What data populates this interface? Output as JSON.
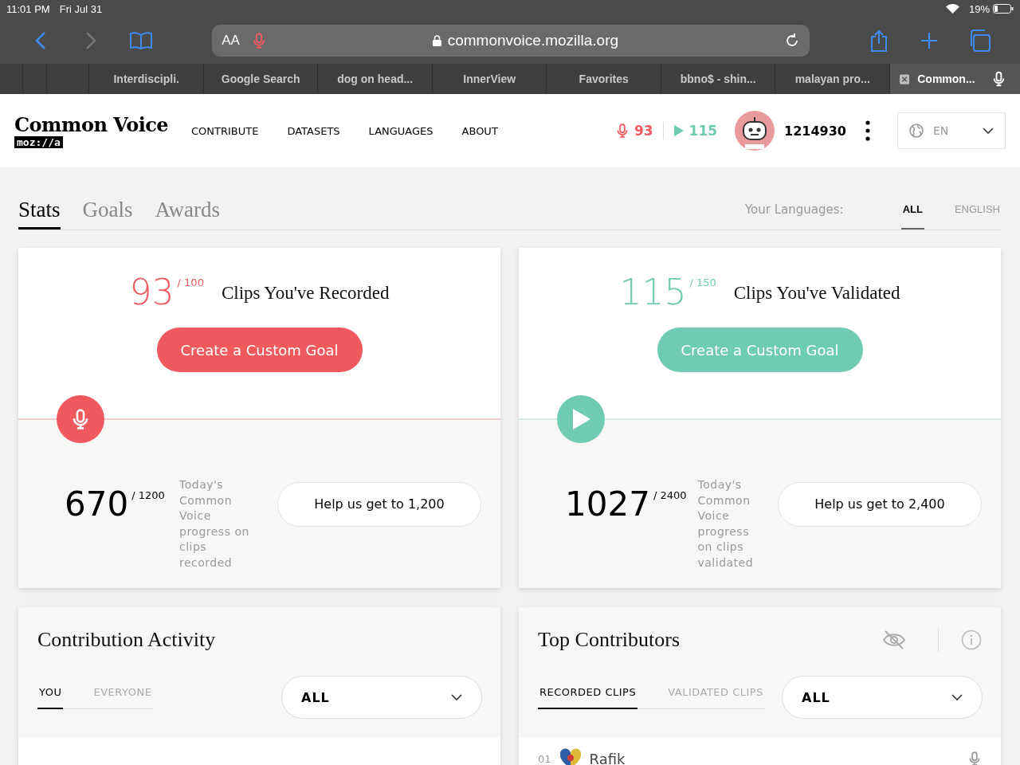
{
  "status_bar": {
    "time": "11:01 PM",
    "date": "Fri Jul 31",
    "battery": "19%"
  },
  "browser": {
    "text_size": "AA",
    "url": "commonvoice.mozilla.org"
  },
  "browser_tabs": [
    {
      "title": "Interdiscipli.",
      "selected": false
    },
    {
      "title": "Google Search",
      "selected": false
    },
    {
      "title": "dog on head...",
      "selected": false
    },
    {
      "title": "InnerView",
      "selected": false
    },
    {
      "title": "Favorites",
      "selected": false
    },
    {
      "title": "bbno$ - shin...",
      "selected": false
    },
    {
      "title": "malayan pro...",
      "selected": false
    },
    {
      "title": "Common...",
      "selected": true
    }
  ],
  "site": {
    "logo": "Common Voice",
    "badge": "moz://a",
    "nav": [
      "CONTRIBUTE",
      "DATASETS",
      "LANGUAGES",
      "ABOUT"
    ],
    "recorded_count": "93",
    "validated_count": "115",
    "username": "1214930",
    "language": "EN"
  },
  "page_tabs": [
    {
      "label": "Stats",
      "selected": true
    },
    {
      "label": "Goals",
      "selected": false
    },
    {
      "label": "Awards",
      "selected": false
    }
  ],
  "languages": {
    "label": "Your Languages:",
    "options": [
      {
        "label": "ALL",
        "selected": true
      },
      {
        "label": "ENGLISH",
        "selected": false
      }
    ]
  },
  "goal_cards": [
    {
      "kind": "record",
      "count": "93",
      "goal": "/ 100",
      "title": "Clips You've Recorded",
      "button": "Create a Custom Goal",
      "total": "670",
      "total_goal": "/ 1200",
      "caption": "Today's Common Voice progress on clips recorded",
      "help_button": "Help us get to 1,200"
    },
    {
      "kind": "validate",
      "count": "115",
      "goal": "/ 150",
      "title": "Clips You've Validated",
      "button": "Create a Custom Goal",
      "total": "1027",
      "total_goal": "/ 2400",
      "caption": "Today's Common Voice progress on clips validated",
      "help_button": "Help us get to 2,400"
    }
  ],
  "activity": {
    "title": "Contribution Activity",
    "tabs": [
      {
        "label": "YOU",
        "selected": true
      },
      {
        "label": "EVERYONE",
        "selected": false
      }
    ],
    "filter": "ALL"
  },
  "top_contributors": {
    "title": "Top Contributors",
    "tabs": [
      {
        "label": "RECORDED CLIPS",
        "selected": true
      },
      {
        "label": "VALIDATED CLIPS",
        "selected": false
      }
    ],
    "filter": "ALL",
    "rows": [
      {
        "rank": "01",
        "name": "Rafik"
      }
    ]
  }
}
